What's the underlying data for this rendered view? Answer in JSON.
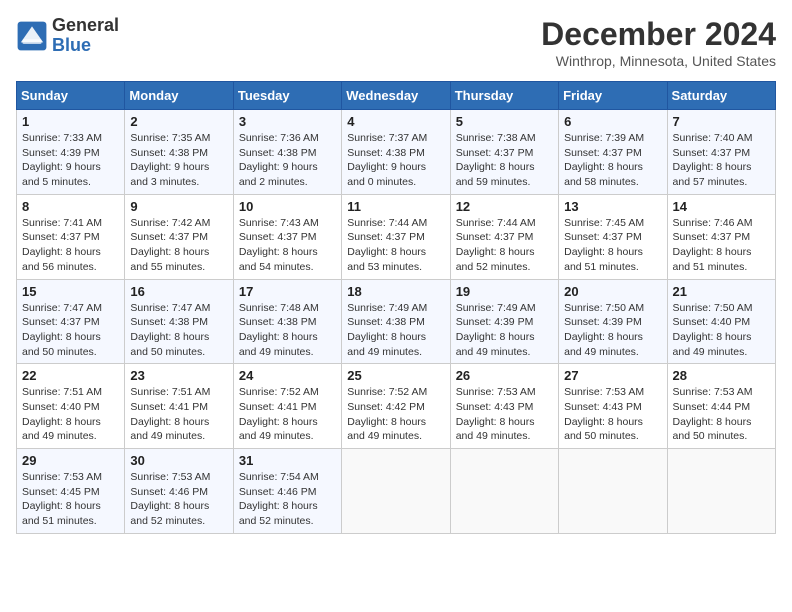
{
  "header": {
    "logo_line1": "General",
    "logo_line2": "Blue",
    "title": "December 2024",
    "subtitle": "Winthrop, Minnesota, United States"
  },
  "days_of_week": [
    "Sunday",
    "Monday",
    "Tuesday",
    "Wednesday",
    "Thursday",
    "Friday",
    "Saturday"
  ],
  "weeks": [
    [
      {
        "num": "1",
        "sunrise": "Sunrise: 7:33 AM",
        "sunset": "Sunset: 4:39 PM",
        "daylight": "Daylight: 9 hours and 5 minutes."
      },
      {
        "num": "2",
        "sunrise": "Sunrise: 7:35 AM",
        "sunset": "Sunset: 4:38 PM",
        "daylight": "Daylight: 9 hours and 3 minutes."
      },
      {
        "num": "3",
        "sunrise": "Sunrise: 7:36 AM",
        "sunset": "Sunset: 4:38 PM",
        "daylight": "Daylight: 9 hours and 2 minutes."
      },
      {
        "num": "4",
        "sunrise": "Sunrise: 7:37 AM",
        "sunset": "Sunset: 4:38 PM",
        "daylight": "Daylight: 9 hours and 0 minutes."
      },
      {
        "num": "5",
        "sunrise": "Sunrise: 7:38 AM",
        "sunset": "Sunset: 4:37 PM",
        "daylight": "Daylight: 8 hours and 59 minutes."
      },
      {
        "num": "6",
        "sunrise": "Sunrise: 7:39 AM",
        "sunset": "Sunset: 4:37 PM",
        "daylight": "Daylight: 8 hours and 58 minutes."
      },
      {
        "num": "7",
        "sunrise": "Sunrise: 7:40 AM",
        "sunset": "Sunset: 4:37 PM",
        "daylight": "Daylight: 8 hours and 57 minutes."
      }
    ],
    [
      {
        "num": "8",
        "sunrise": "Sunrise: 7:41 AM",
        "sunset": "Sunset: 4:37 PM",
        "daylight": "Daylight: 8 hours and 56 minutes."
      },
      {
        "num": "9",
        "sunrise": "Sunrise: 7:42 AM",
        "sunset": "Sunset: 4:37 PM",
        "daylight": "Daylight: 8 hours and 55 minutes."
      },
      {
        "num": "10",
        "sunrise": "Sunrise: 7:43 AM",
        "sunset": "Sunset: 4:37 PM",
        "daylight": "Daylight: 8 hours and 54 minutes."
      },
      {
        "num": "11",
        "sunrise": "Sunrise: 7:44 AM",
        "sunset": "Sunset: 4:37 PM",
        "daylight": "Daylight: 8 hours and 53 minutes."
      },
      {
        "num": "12",
        "sunrise": "Sunrise: 7:44 AM",
        "sunset": "Sunset: 4:37 PM",
        "daylight": "Daylight: 8 hours and 52 minutes."
      },
      {
        "num": "13",
        "sunrise": "Sunrise: 7:45 AM",
        "sunset": "Sunset: 4:37 PM",
        "daylight": "Daylight: 8 hours and 51 minutes."
      },
      {
        "num": "14",
        "sunrise": "Sunrise: 7:46 AM",
        "sunset": "Sunset: 4:37 PM",
        "daylight": "Daylight: 8 hours and 51 minutes."
      }
    ],
    [
      {
        "num": "15",
        "sunrise": "Sunrise: 7:47 AM",
        "sunset": "Sunset: 4:37 PM",
        "daylight": "Daylight: 8 hours and 50 minutes."
      },
      {
        "num": "16",
        "sunrise": "Sunrise: 7:47 AM",
        "sunset": "Sunset: 4:38 PM",
        "daylight": "Daylight: 8 hours and 50 minutes."
      },
      {
        "num": "17",
        "sunrise": "Sunrise: 7:48 AM",
        "sunset": "Sunset: 4:38 PM",
        "daylight": "Daylight: 8 hours and 49 minutes."
      },
      {
        "num": "18",
        "sunrise": "Sunrise: 7:49 AM",
        "sunset": "Sunset: 4:38 PM",
        "daylight": "Daylight: 8 hours and 49 minutes."
      },
      {
        "num": "19",
        "sunrise": "Sunrise: 7:49 AM",
        "sunset": "Sunset: 4:39 PM",
        "daylight": "Daylight: 8 hours and 49 minutes."
      },
      {
        "num": "20",
        "sunrise": "Sunrise: 7:50 AM",
        "sunset": "Sunset: 4:39 PM",
        "daylight": "Daylight: 8 hours and 49 minutes."
      },
      {
        "num": "21",
        "sunrise": "Sunrise: 7:50 AM",
        "sunset": "Sunset: 4:40 PM",
        "daylight": "Daylight: 8 hours and 49 minutes."
      }
    ],
    [
      {
        "num": "22",
        "sunrise": "Sunrise: 7:51 AM",
        "sunset": "Sunset: 4:40 PM",
        "daylight": "Daylight: 8 hours and 49 minutes."
      },
      {
        "num": "23",
        "sunrise": "Sunrise: 7:51 AM",
        "sunset": "Sunset: 4:41 PM",
        "daylight": "Daylight: 8 hours and 49 minutes."
      },
      {
        "num": "24",
        "sunrise": "Sunrise: 7:52 AM",
        "sunset": "Sunset: 4:41 PM",
        "daylight": "Daylight: 8 hours and 49 minutes."
      },
      {
        "num": "25",
        "sunrise": "Sunrise: 7:52 AM",
        "sunset": "Sunset: 4:42 PM",
        "daylight": "Daylight: 8 hours and 49 minutes."
      },
      {
        "num": "26",
        "sunrise": "Sunrise: 7:53 AM",
        "sunset": "Sunset: 4:43 PM",
        "daylight": "Daylight: 8 hours and 49 minutes."
      },
      {
        "num": "27",
        "sunrise": "Sunrise: 7:53 AM",
        "sunset": "Sunset: 4:43 PM",
        "daylight": "Daylight: 8 hours and 50 minutes."
      },
      {
        "num": "28",
        "sunrise": "Sunrise: 7:53 AM",
        "sunset": "Sunset: 4:44 PM",
        "daylight": "Daylight: 8 hours and 50 minutes."
      }
    ],
    [
      {
        "num": "29",
        "sunrise": "Sunrise: 7:53 AM",
        "sunset": "Sunset: 4:45 PM",
        "daylight": "Daylight: 8 hours and 51 minutes."
      },
      {
        "num": "30",
        "sunrise": "Sunrise: 7:53 AM",
        "sunset": "Sunset: 4:46 PM",
        "daylight": "Daylight: 8 hours and 52 minutes."
      },
      {
        "num": "31",
        "sunrise": "Sunrise: 7:54 AM",
        "sunset": "Sunset: 4:46 PM",
        "daylight": "Daylight: 8 hours and 52 minutes."
      },
      null,
      null,
      null,
      null
    ]
  ]
}
